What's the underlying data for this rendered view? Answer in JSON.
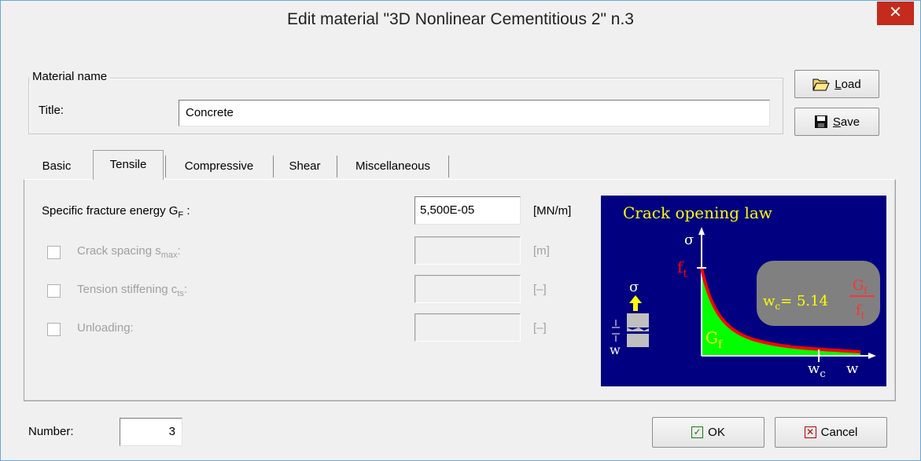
{
  "window": {
    "title": "Edit material  \"3D Nonlinear Cementitious 2\" n.3",
    "close_symbol": "✕"
  },
  "material": {
    "group_label": "Material name",
    "title_label": "Title:",
    "title_value": "Concrete"
  },
  "buttons": {
    "load_label_u": "L",
    "load_label_rest": "oad",
    "save_label_u": "S",
    "save_label_rest": "ave",
    "ok_label": "OK",
    "cancel_label": "Cancel"
  },
  "tabs": [
    {
      "label": "Basic"
    },
    {
      "label": "Tensile"
    },
    {
      "label": "Compressive"
    },
    {
      "label": "Shear"
    },
    {
      "label": "Miscellaneous"
    }
  ],
  "active_tab": "Tensile",
  "tensile": {
    "fracture_label": "Specific fracture energy G",
    "fracture_sub": "F",
    "fracture_colon": " :",
    "fracture_value": "5,500E-05",
    "fracture_unit": "[MN/m]",
    "rows": [
      {
        "label": "Crack spacing s",
        "sub": "max",
        "suffix": ":",
        "unit": "[m]",
        "checked": false
      },
      {
        "label": "Tension stiffening c",
        "sub": "ts",
        "suffix": ":",
        "unit": "[–]",
        "checked": false
      },
      {
        "label": "Unloading:",
        "sub": "",
        "suffix": "",
        "unit": "[–]",
        "checked": false
      }
    ]
  },
  "diagram": {
    "title": "Crack opening law",
    "sigma": "σ",
    "ft": "f",
    "ft_sub": "t",
    "gf": "G",
    "gf_sub": "f",
    "w": "w",
    "wc": "w",
    "wc_sub": "c",
    "formula_lhs": "w",
    "formula_lhs_sub": "c",
    "formula_mid": "= 5.14",
    "formula_num": "G",
    "formula_num_sub": "f",
    "formula_den": "f",
    "formula_den_sub": "t",
    "colors": {
      "background": "#000080",
      "text": "#ffff00",
      "curve": "#ff0000",
      "area": "#00ff00",
      "axes": "#ffffff",
      "bubble": "#808080"
    }
  },
  "footer": {
    "number_label": "Number:",
    "number_value": "3"
  }
}
